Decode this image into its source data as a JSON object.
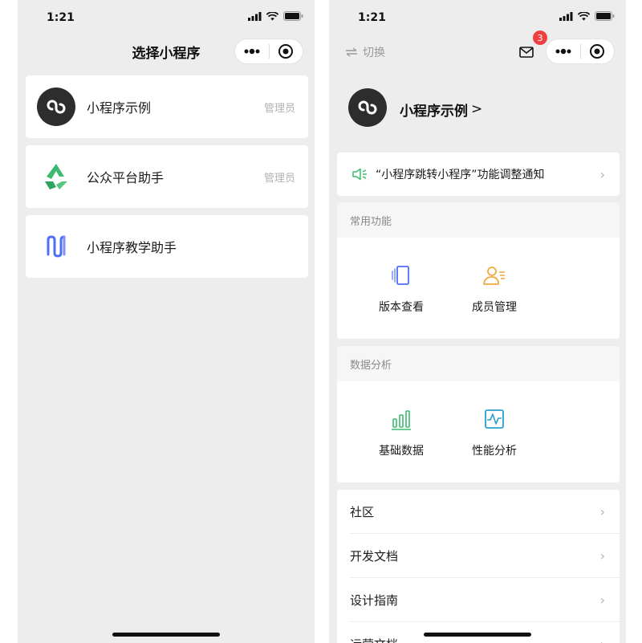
{
  "left": {
    "status_time": "1:21",
    "nav_title": "选择小程序",
    "items": [
      {
        "name": "小程序示例",
        "role": "管理员",
        "icon": "mini-program-logo-icon"
      },
      {
        "name": "公众平台助手",
        "role": "管理员",
        "icon": "recycle-logo-icon"
      },
      {
        "name": "小程序教学助手",
        "role": "",
        "icon": "teaching-logo-icon"
      }
    ]
  },
  "right": {
    "status_time": "1:21",
    "switch_label": "切换",
    "mail_badge": "3",
    "profile_name": "小程序示例",
    "profile_chevron": ">",
    "notice_text": "“小程序跳转小程序”功能调整通知",
    "sections": [
      {
        "title": "常用功能",
        "items": [
          {
            "label": "版本查看",
            "icon": "version-icon"
          },
          {
            "label": "成员管理",
            "icon": "member-icon"
          }
        ]
      },
      {
        "title": "数据分析",
        "items": [
          {
            "label": "基础数据",
            "icon": "bar-chart-icon"
          },
          {
            "label": "性能分析",
            "icon": "performance-icon"
          }
        ]
      }
    ],
    "menu": [
      "社区",
      "开发文档",
      "设计指南",
      "运营文档"
    ],
    "chevron": "›"
  },
  "colors": {
    "background": "#ededed",
    "badge": "#f04142",
    "green": "#3cbb6f",
    "blue": "#4f6ef7",
    "orange": "#f3a93c",
    "teal": "#2a9fd0"
  }
}
